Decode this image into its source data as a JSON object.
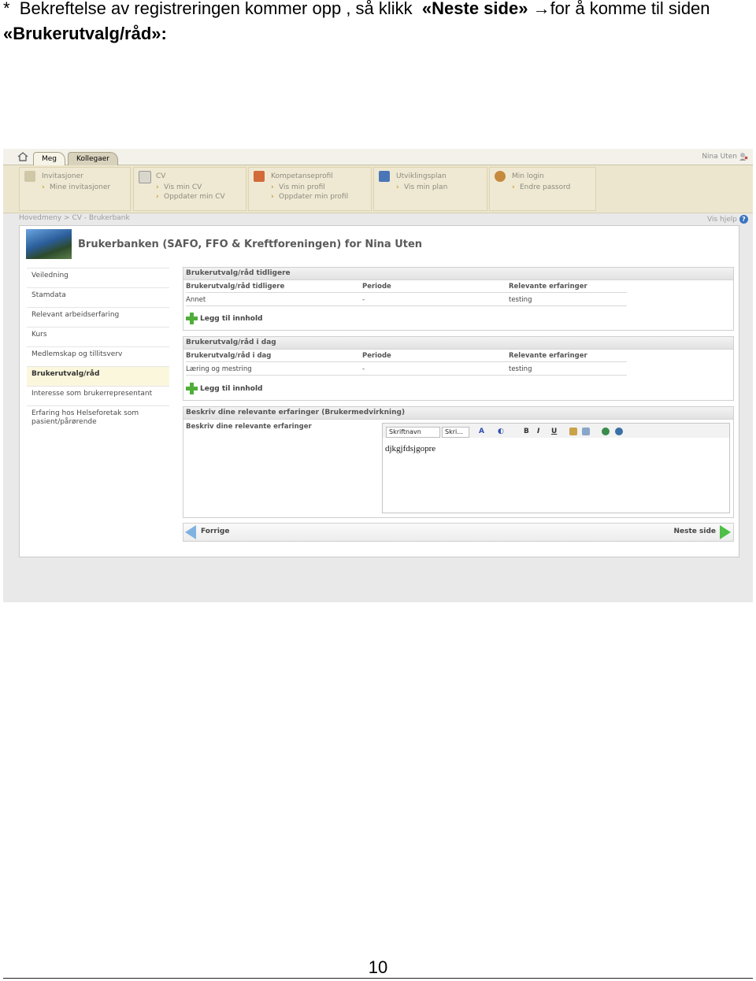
{
  "instruction": {
    "bullet": "*",
    "text_before": "Bekreftelse av registreringen kommer opp , så klikk",
    "button_ref": "«Neste side»",
    "arrow": "→",
    "text_after": "for å komme til siden",
    "line2": "«Brukerutvalg/råd»:"
  },
  "page_number": "10",
  "screenshot": {
    "tabs": [
      "Meg",
      "Kollegaer"
    ],
    "user_name": "Nina Uten",
    "menu": [
      {
        "title": "Invitasjoner",
        "links": [
          "Mine invitasjoner"
        ],
        "icon": "invitation-icon"
      },
      {
        "title": "CV",
        "links": [
          "Vis min CV",
          "Oppdater min CV"
        ],
        "icon": "cv-icon"
      },
      {
        "title": "Kompetanseprofil",
        "links": [
          "Vis min profil",
          "Oppdater min profil"
        ],
        "icon": "profile-icon"
      },
      {
        "title": "Utviklingsplan",
        "links": [
          "Vis min plan"
        ],
        "icon": "plan-icon"
      },
      {
        "title": "Min login",
        "links": [
          "Endre passord"
        ],
        "icon": "login-icon"
      }
    ],
    "breadcrumb": "Hovedmeny  >  CV - Brukerbank",
    "help": "Vis hjelp",
    "main_title": "Brukerbanken (SAFO, FFO & Kreftforeningen) for Nina Uten",
    "nav": [
      "Veiledning",
      "Stamdata",
      "Relevant arbeidserfaring",
      "Kurs",
      "Medlemskap og tillitsverv",
      "Brukerutvalg/råd",
      "Interesse som brukerrepresentant",
      "Erfaring hos Helseforetak som pasient/pårørende"
    ],
    "section1": {
      "title": "Brukerutvalg/råd tidligere",
      "columns": [
        "Brukerutvalg/råd tidligere",
        "Periode",
        "Relevante erfaringer"
      ],
      "row": [
        "Annet",
        "-",
        "testing"
      ],
      "add": "Legg til innhold"
    },
    "section2": {
      "title": "Brukerutvalg/råd i dag",
      "columns": [
        "Brukerutvalg/råd i dag",
        "Periode",
        "Relevante erfaringer"
      ],
      "row": [
        "Læring og mestring",
        "-",
        "testing"
      ],
      "add": "Legg til innhold"
    },
    "section3": {
      "title": "Beskriv dine relevante erfaringer (Brukermedvirkning)",
      "label": "Beskriv dine relevante erfaringer",
      "font_select": "Skriftnavn",
      "size_select": "Skri...",
      "editor_text": "djkgjfdsjgopre"
    },
    "prev": "Forrige",
    "next": "Neste side"
  }
}
